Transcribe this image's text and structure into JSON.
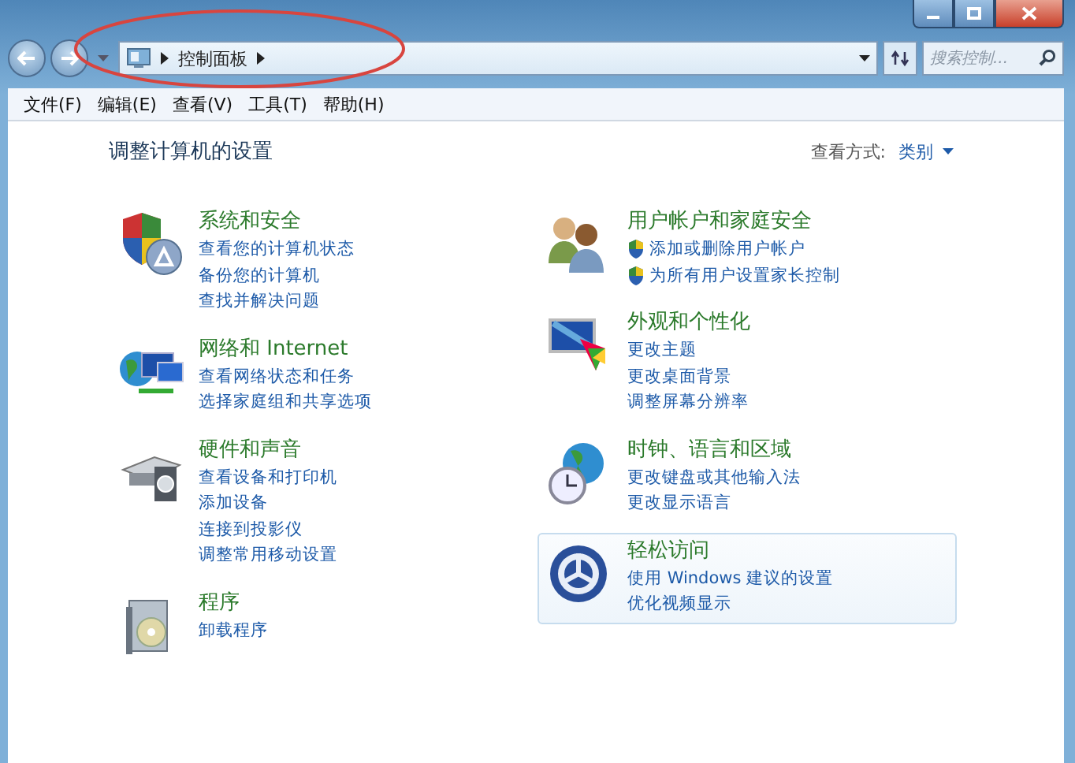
{
  "window": {
    "caption_buttons": [
      {
        "kind": "minimize"
      },
      {
        "kind": "maximize"
      },
      {
        "kind": "close"
      }
    ]
  },
  "address_bar": {
    "crumbs": [
      "控制面板"
    ]
  },
  "search": {
    "placeholder": "搜索控制..."
  },
  "menu": [
    "文件(F)",
    "编辑(E)",
    "查看(V)",
    "工具(T)",
    "帮助(H)"
  ],
  "heading": "调整计算机的设置",
  "view_by": {
    "label": "查看方式:",
    "value": "类别"
  },
  "columns": [
    [
      {
        "title": "系统和安全",
        "hovered": false,
        "links": [
          {
            "text": "查看您的计算机状态",
            "shield": false
          },
          {
            "text": "备份您的计算机",
            "shield": false
          },
          {
            "text": "查找并解决问题",
            "shield": false
          }
        ]
      },
      {
        "title": "网络和 Internet",
        "hovered": false,
        "links": [
          {
            "text": "查看网络状态和任务",
            "shield": false
          },
          {
            "text": "选择家庭组和共享选项",
            "shield": false
          }
        ]
      },
      {
        "title": "硬件和声音",
        "hovered": false,
        "links": [
          {
            "text": "查看设备和打印机",
            "shield": false
          },
          {
            "text": "添加设备",
            "shield": false
          },
          {
            "text": "连接到投影仪",
            "shield": false
          },
          {
            "text": "调整常用移动设置",
            "shield": false
          }
        ]
      },
      {
        "title": "程序",
        "hovered": false,
        "links": [
          {
            "text": "卸载程序",
            "shield": false
          }
        ]
      }
    ],
    [
      {
        "title": "用户帐户和家庭安全",
        "hovered": false,
        "links": [
          {
            "text": "添加或删除用户帐户",
            "shield": true
          },
          {
            "text": "为所有用户设置家长控制",
            "shield": true
          }
        ]
      },
      {
        "title": "外观和个性化",
        "hovered": false,
        "links": [
          {
            "text": "更改主题",
            "shield": false
          },
          {
            "text": "更改桌面背景",
            "shield": false
          },
          {
            "text": "调整屏幕分辨率",
            "shield": false
          }
        ]
      },
      {
        "title": "时钟、语言和区域",
        "hovered": false,
        "links": [
          {
            "text": "更改键盘或其他输入法",
            "shield": false
          },
          {
            "text": "更改显示语言",
            "shield": false
          }
        ]
      },
      {
        "title": "轻松访问",
        "hovered": true,
        "links": [
          {
            "text": "使用 Windows 建议的设置",
            "shield": false
          },
          {
            "text": "优化视频显示",
            "shield": false
          }
        ]
      }
    ]
  ],
  "annotation": {
    "kind": "ellipse"
  }
}
